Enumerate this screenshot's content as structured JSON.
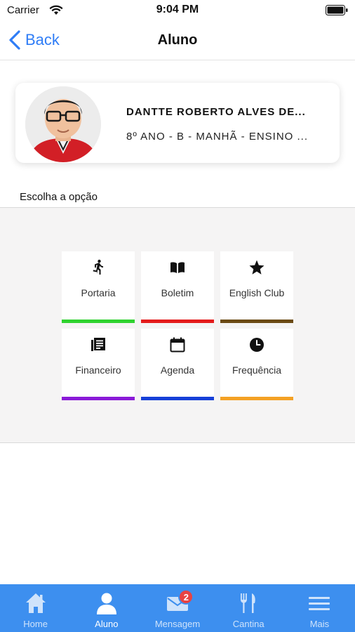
{
  "status_bar": {
    "carrier": "Carrier",
    "time": "9:04 PM"
  },
  "nav": {
    "back_label": "Back",
    "title": "Aluno"
  },
  "student": {
    "name": "DANTTE ROBERTO ALVES DE...",
    "class_info": "8º ANO - B - MANHÃ - ENSINO ..."
  },
  "choose_label": "Escolha a opção",
  "options": [
    {
      "label": "Portaria",
      "icon": "walking-person-icon",
      "color": "#2fd22f"
    },
    {
      "label": "Boletim",
      "icon": "open-book-icon",
      "color": "#e41b1b"
    },
    {
      "label": "English Club",
      "icon": "star-icon",
      "color": "#6b4a14"
    },
    {
      "label": "Financeiro",
      "icon": "ledger-icon",
      "color": "#8a1ad8"
    },
    {
      "label": "Agenda",
      "icon": "calendar-icon",
      "color": "#1640d8"
    },
    {
      "label": "Frequência",
      "icon": "clock-icon",
      "color": "#f4a124"
    }
  ],
  "tabs": [
    {
      "label": "Home",
      "icon": "home-icon"
    },
    {
      "label": "Aluno",
      "icon": "person-icon",
      "active": true
    },
    {
      "label": "Mensagem",
      "icon": "envelope-icon",
      "badge": "2"
    },
    {
      "label": "Cantina",
      "icon": "fork-knife-icon"
    },
    {
      "label": "Mais",
      "icon": "menu-icon"
    }
  ],
  "colors": {
    "accent": "#2f7df6",
    "tab_bar": "#3d8fef",
    "badge": "#e84343"
  }
}
